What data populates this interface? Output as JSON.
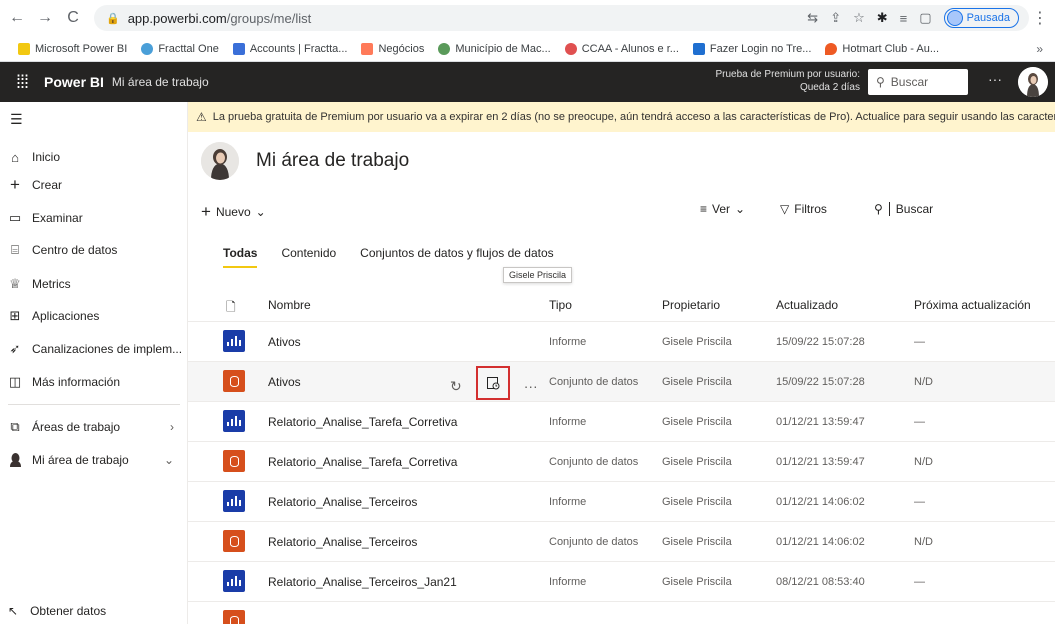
{
  "browser": {
    "url_host": "app.powerbi.com",
    "url_path": "/groups/me/list",
    "profile_status": "Pausada",
    "bookmarks": [
      "Microsoft Power BI",
      "Fracttal One",
      "Accounts | Fractta...",
      "Negócios",
      "Município de Mac...",
      "CCAA - Alunos e r...",
      "Fazer Login no Tre...",
      "Hotmart Club - Au..."
    ],
    "bookmarks_more": "»"
  },
  "appbar": {
    "brand": "Power BI",
    "workspace": "Mi área de trabajo",
    "trial_line1": "Prueba de Premium por usuario:",
    "trial_line2": "Queda 2 días",
    "search_placeholder": "Buscar",
    "more": "···"
  },
  "sidebar": {
    "items": [
      {
        "label": "Inicio",
        "icon": "home-icon"
      },
      {
        "label": "Crear",
        "icon": "plus-icon"
      },
      {
        "label": "Examinar",
        "icon": "folder-icon"
      },
      {
        "label": "Centro de datos",
        "icon": "database-icon"
      },
      {
        "label": "Metrics",
        "icon": "trophy-icon"
      },
      {
        "label": "Aplicaciones",
        "icon": "apps-icon"
      },
      {
        "label": "Canalizaciones de implem...",
        "icon": "rocket-icon"
      },
      {
        "label": "Más información",
        "icon": "book-icon"
      },
      {
        "label": "Áreas de trabajo",
        "icon": "workspaces-icon"
      },
      {
        "label": "Mi área de trabajo",
        "icon": "avatar-icon"
      }
    ],
    "get_data": "Obtener datos"
  },
  "banner": {
    "text": "La prueba gratuita de Premium por usuario va a expirar en 2 días (no se preocupe, aún tendrá acceso a las características de Pro). Actualice para seguir usando las características de"
  },
  "workspace": {
    "title": "Mi área de trabajo",
    "new_label": "Nuevo",
    "view_label": "Ver",
    "filters_label": "Filtros",
    "search_label": "Buscar"
  },
  "tabs": [
    "Todas",
    "Contenido",
    "Conjuntos de datos y flujos de datos"
  ],
  "table": {
    "headers": {
      "name": "Nombre",
      "type": "Tipo",
      "owner": "Propietario",
      "updated": "Actualizado",
      "next": "Próxima actualización"
    },
    "rows": [
      {
        "name": "Ativos",
        "type": "Informe",
        "owner": "Gisele Priscila",
        "updated": "15/09/22 15:07:28",
        "next": "—",
        "kind": "report"
      },
      {
        "name": "Ativos",
        "type": "Conjunto de datos",
        "owner": "Gisele Priscila",
        "updated": "15/09/22 15:07:28",
        "next": "N/D",
        "kind": "dataset"
      },
      {
        "name": "Relatorio_Analise_Tarefa_Corretiva",
        "type": "Informe",
        "owner": "Gisele Priscila",
        "updated": "01/12/21 13:59:47",
        "next": "—",
        "kind": "report"
      },
      {
        "name": "Relatorio_Analise_Tarefa_Corretiva",
        "type": "Conjunto de datos",
        "owner": "Gisele Priscila",
        "updated": "01/12/21 13:59:47",
        "next": "N/D",
        "kind": "dataset"
      },
      {
        "name": "Relatorio_Analise_Terceiros",
        "type": "Informe",
        "owner": "Gisele Priscila",
        "updated": "01/12/21 14:06:02",
        "next": "—",
        "kind": "report"
      },
      {
        "name": "Relatorio_Analise_Terceiros",
        "type": "Conjunto de datos",
        "owner": "Gisele Priscila",
        "updated": "01/12/21 14:06:02",
        "next": "N/D",
        "kind": "dataset"
      },
      {
        "name": "Relatorio_Analise_Terceiros_Jan21",
        "type": "Informe",
        "owner": "Gisele Priscila",
        "updated": "08/12/21 08:53:40",
        "next": "—",
        "kind": "report"
      }
    ],
    "tooltip": "Gisele Priscila"
  },
  "colors": {
    "report": "#1a3ca8",
    "dataset": "#d64f1c",
    "highlight": "#d32f2f",
    "banner": "#fff4ce"
  }
}
